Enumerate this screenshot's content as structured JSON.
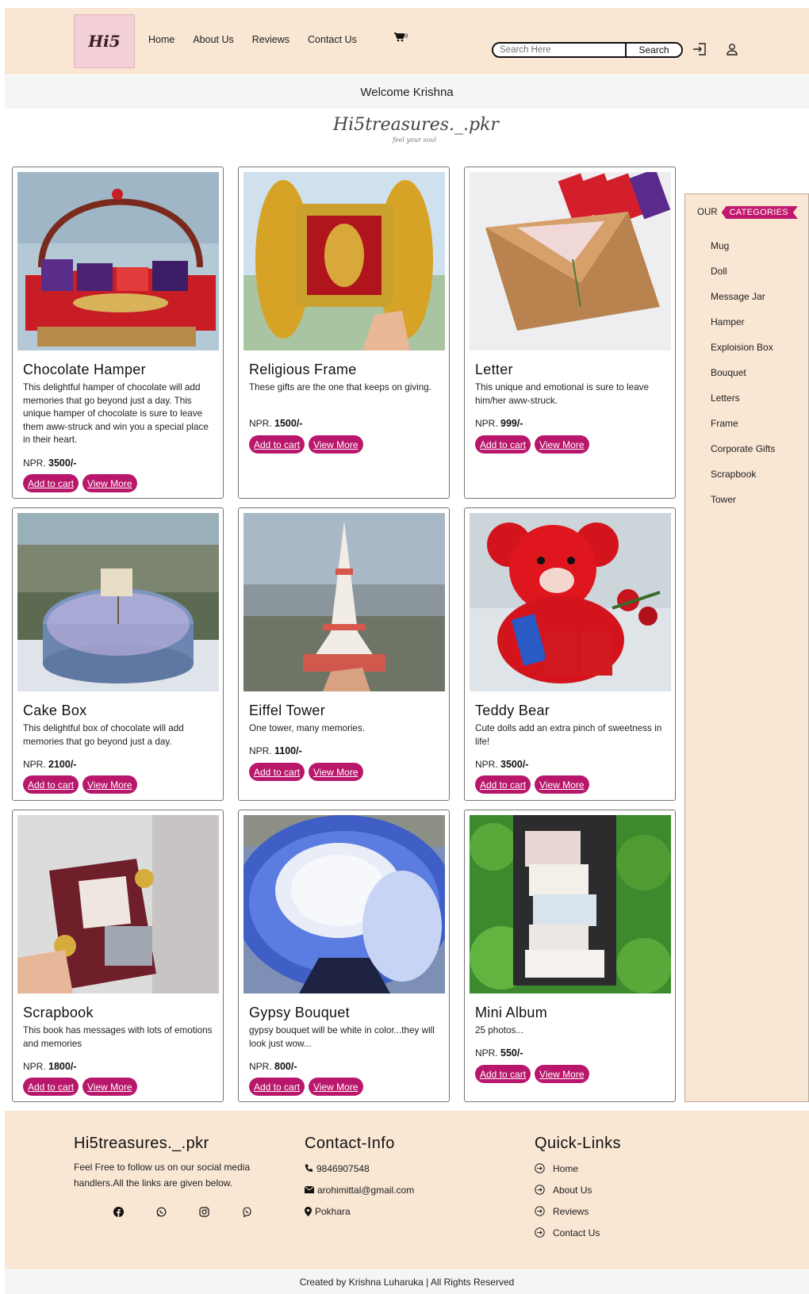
{
  "header": {
    "logo_text": "Hi5",
    "nav": [
      "Home",
      "About Us",
      "Reviews",
      "Contact Us"
    ],
    "cart_count": "0",
    "search_placeholder": "Search Here",
    "search_button": "Search"
  },
  "welcome": "Welcome Krishna",
  "brand": {
    "name": "Hi5treasures._.pkr",
    "tagline": "feel your soul"
  },
  "products": [
    {
      "title": "Chocolate Hamper",
      "desc": "This delightful hamper of chocolate will add memories that go beyond just a day. This unique hamper of chocolate is sure to leave them aww-struck and win you a special place in their heart.",
      "currency": "NPR.",
      "price": "3500/-",
      "add": "Add to cart",
      "view": "View More"
    },
    {
      "title": "Religious Frame",
      "desc": "These gifts are the one that keeps on giving.",
      "currency": "NPR.",
      "price": "1500/-",
      "add": "Add to cart",
      "view": "View More"
    },
    {
      "title": "Letter",
      "desc": "This unique and emotional is sure to leave him/her aww-struck.",
      "currency": "NPR.",
      "price": "999/-",
      "add": "Add to cart",
      "view": "View More"
    },
    {
      "title": "Cake Box",
      "desc": "This delightful box of chocolate will add memories that go beyond just a day.",
      "currency": "NPR.",
      "price": "2100/-",
      "add": "Add to cart",
      "view": "View More"
    },
    {
      "title": "Eiffel Tower",
      "desc": "One tower, many memories.",
      "currency": "NPR.",
      "price": "1100/-",
      "add": "Add to cart",
      "view": "View More"
    },
    {
      "title": "Teddy Bear",
      "desc": "Cute dolls add an extra pinch of sweetness in life!",
      "currency": "NPR.",
      "price": "3500/-",
      "add": "Add to cart",
      "view": "View More"
    },
    {
      "title": "Scrapbook",
      "desc": "This book has messages with lots of emotions and memories",
      "currency": "NPR.",
      "price": "1800/-",
      "add": "Add to cart",
      "view": "View More"
    },
    {
      "title": "Gypsy Bouquet",
      "desc": "gypsy bouquet will be white in color...they will look just wow...",
      "currency": "NPR.",
      "price": "800/-",
      "add": "Add to cart",
      "view": "View More"
    },
    {
      "title": "Mini Album",
      "desc": "25 photos...",
      "currency": "NPR.",
      "price": "550/-",
      "add": "Add to cart",
      "view": "View More"
    }
  ],
  "sidebar": {
    "our": "OUR",
    "categories_label": "CATEGORIES",
    "items": [
      "Mug",
      "Doll",
      "Message Jar",
      "Hamper",
      "Exploision Box",
      "Bouquet",
      "Letters",
      "Frame",
      "Corporate Gifts",
      "Scrapbook",
      "Tower"
    ]
  },
  "footer": {
    "about_title": "Hi5treasures._.pkr",
    "about_text": "Feel Free to follow us on our social media handlers.All the links are given below.",
    "contact_title": "Contact-Info",
    "phone": "9846907548",
    "email": "arohimittal@gmail.com",
    "location": "Pokhara",
    "links_title": "Quick-Links",
    "links": [
      "Home",
      "About Us",
      "Reviews",
      "Contact Us"
    ],
    "copyright": "Created by Krishna Luharuka | All Rights Reserved"
  },
  "colors": {
    "accent": "#b8176c",
    "header_bg": "#f9e6d3",
    "welcome_bg": "#f4f5f7"
  },
  "icons": {
    "login": "sign-in-icon",
    "user": "user-icon",
    "cart": "cart-icon"
  }
}
